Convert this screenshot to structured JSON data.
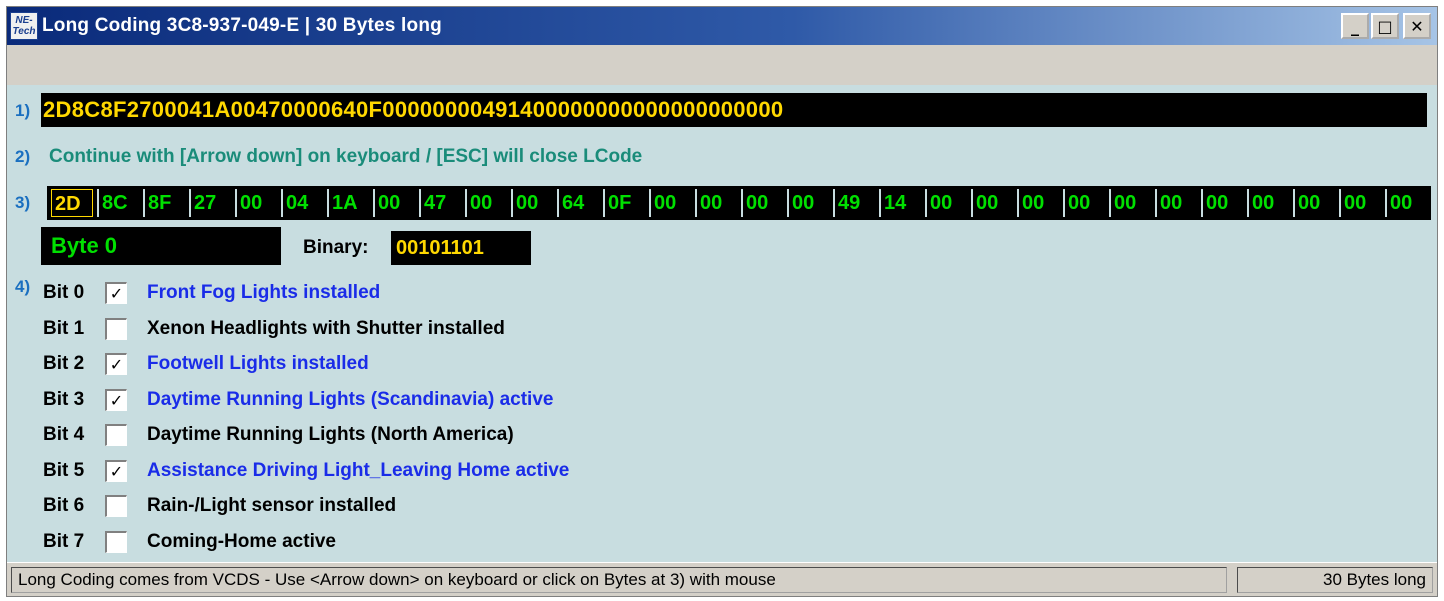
{
  "window": {
    "title": "Long Coding  3C8-937-049-E | 30 Bytes long",
    "icon_text_top": "NE-",
    "icon_text_bottom": "Tech",
    "minimize_glyph": "_",
    "maximize_glyph": "□",
    "close_glyph": "✕"
  },
  "steps": {
    "step1": "1)",
    "step2": "2)",
    "step3": "3)",
    "step4": "4)"
  },
  "coding_string": "2D8C8F2700041A00470000640F00000000491400000000000000000000",
  "instruction": "Continue with [Arrow down] on keyboard / [ESC] will close LCode",
  "bytes": [
    "2D",
    "8C",
    "8F",
    "27",
    "00",
    "04",
    "1A",
    "00",
    "47",
    "00",
    "00",
    "64",
    "0F",
    "00",
    "00",
    "00",
    "00",
    "49",
    "14",
    "00",
    "00",
    "00",
    "00",
    "00",
    "00",
    "00",
    "00",
    "00",
    "00",
    "00"
  ],
  "selected_byte_index": 0,
  "byte_label": "Byte 0",
  "binary_label": "Binary:",
  "binary_value": "00101101",
  "bits": [
    {
      "label": "Bit 0",
      "checked": true,
      "description": "Front Fog Lights installed"
    },
    {
      "label": "Bit 1",
      "checked": false,
      "description": "Xenon Headlights with Shutter installed"
    },
    {
      "label": "Bit 2",
      "checked": true,
      "description": "Footwell Lights installed"
    },
    {
      "label": "Bit 3",
      "checked": true,
      "description": "Daytime Running Lights (Scandinavia) active"
    },
    {
      "label": "Bit 4",
      "checked": false,
      "description": "Daytime Running Lights (North America)"
    },
    {
      "label": "Bit 5",
      "checked": true,
      "description": "Assistance Driving Light_Leaving Home active"
    },
    {
      "label": "Bit 6",
      "checked": false,
      "description": "Rain-/Light sensor installed"
    },
    {
      "label": "Bit 7",
      "checked": false,
      "description": "Coming-Home active"
    }
  ],
  "checkmark_glyph": "✓",
  "colors": {
    "active_text": "#1a2ce8",
    "inactive_text": "#000000",
    "byte_text": "#00e000",
    "selected_text": "#ffd800"
  },
  "status": {
    "main": "Long Coding comes from VCDS - Use <Arrow down> on keyboard or click on Bytes at 3) with mouse",
    "right": "30 Bytes long"
  }
}
